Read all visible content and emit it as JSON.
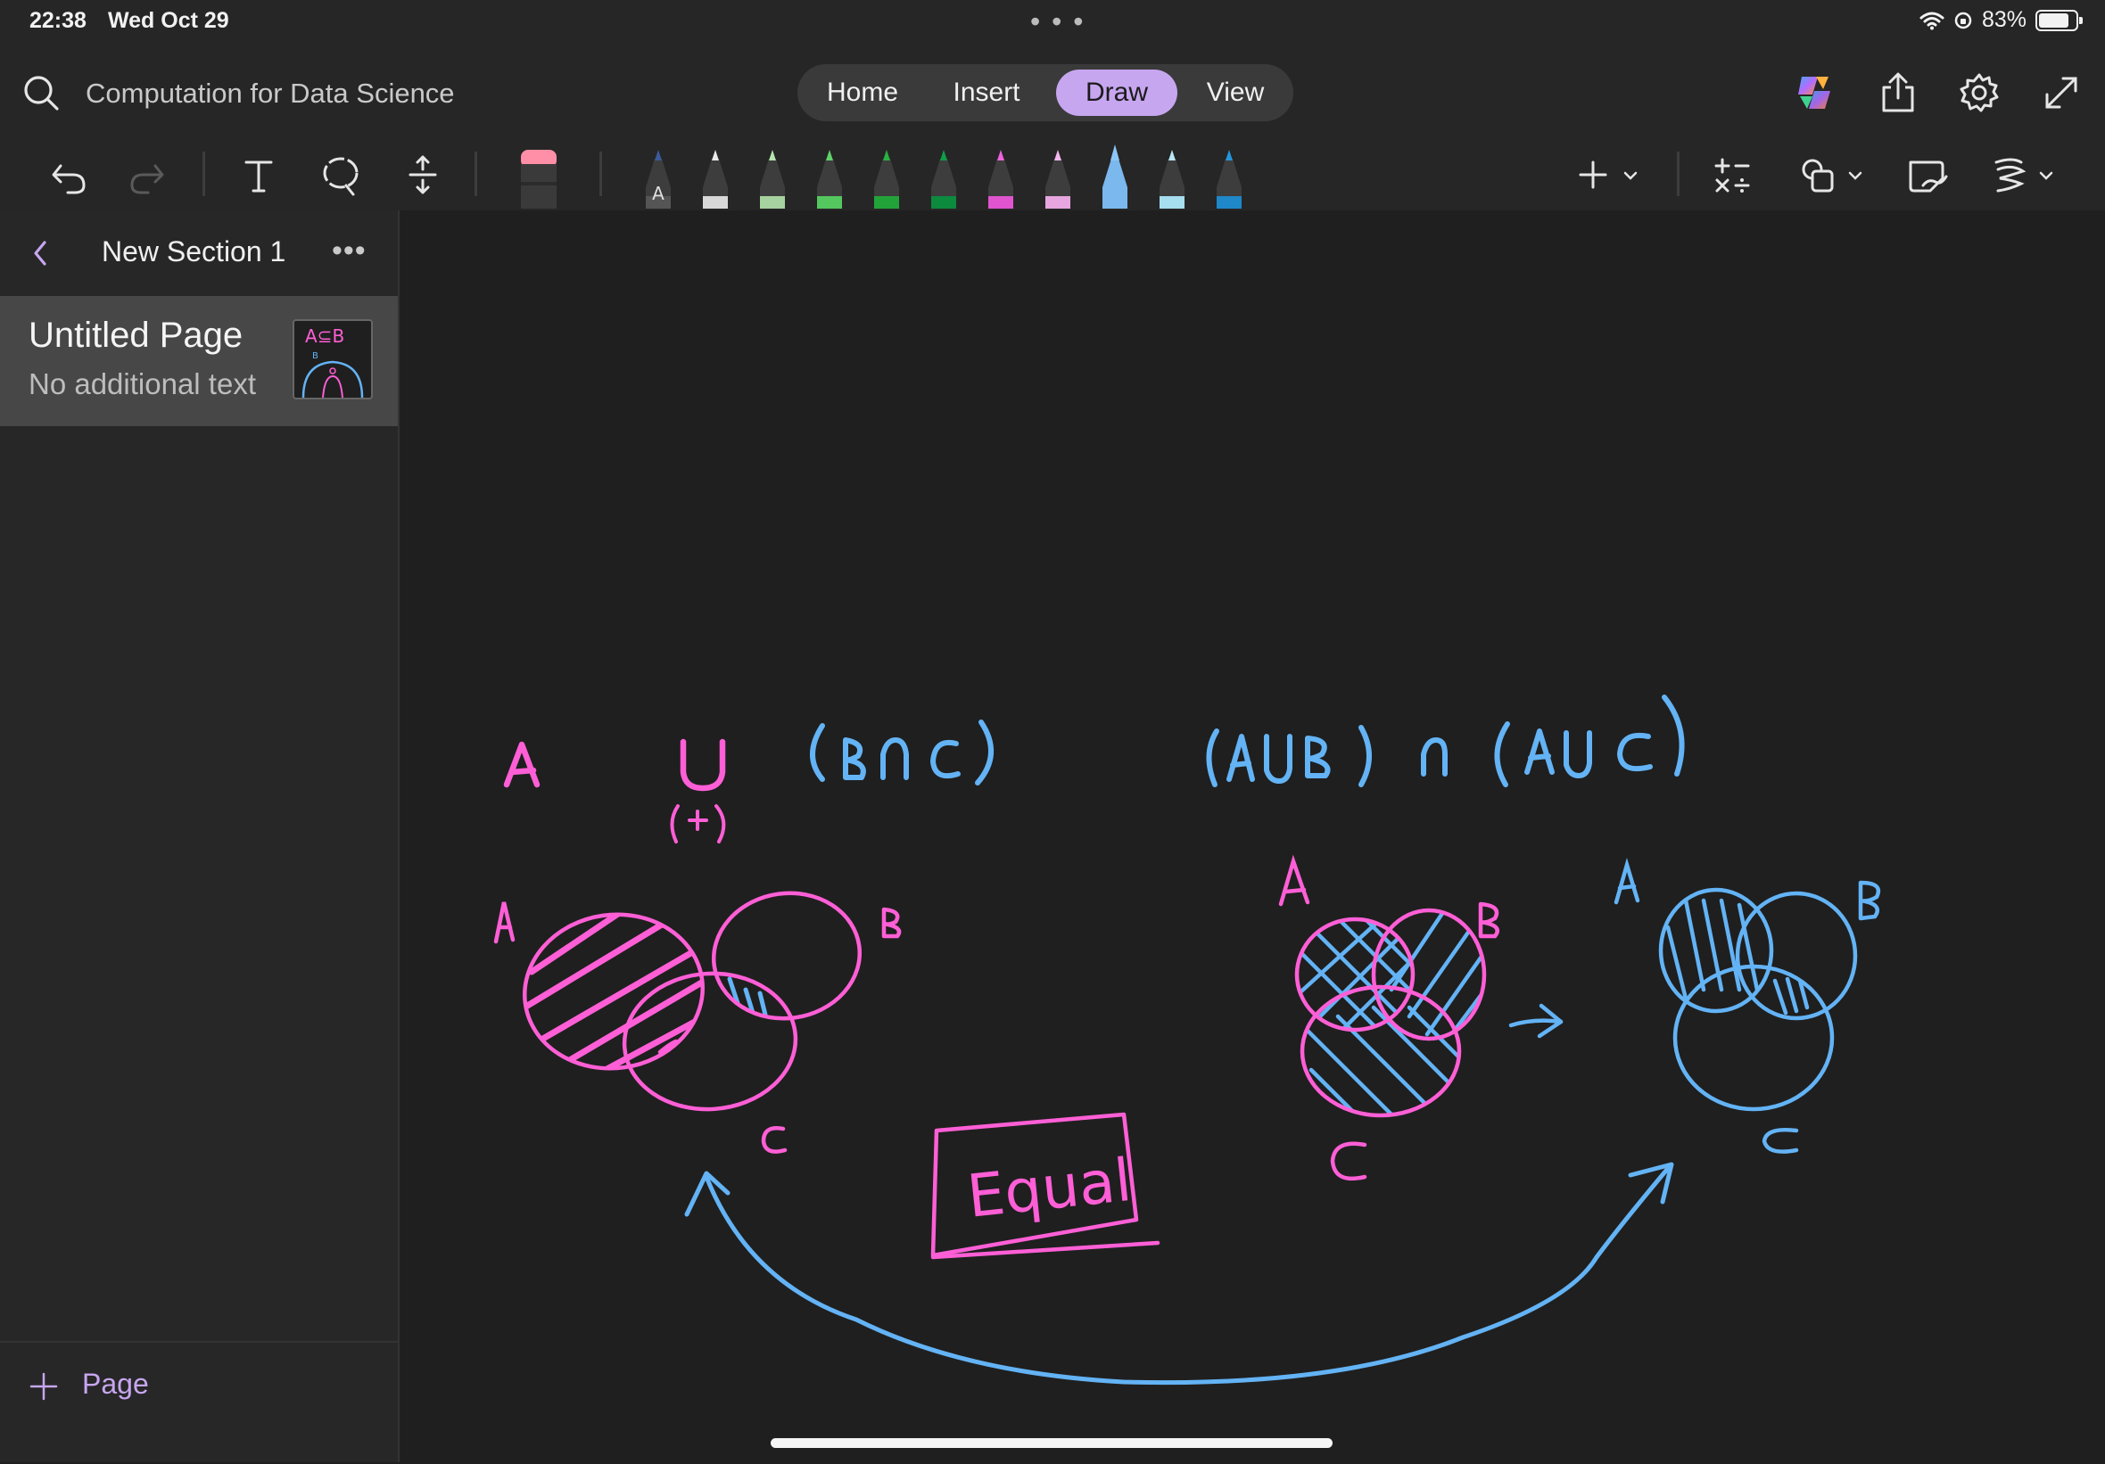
{
  "status_bar": {
    "time": "22:38",
    "date": "Wed Oct 29",
    "battery": "83%",
    "battery_level": 0.83
  },
  "notebook": {
    "title": "Computation for Data Science"
  },
  "tabs": [
    {
      "label": "Home",
      "active": false
    },
    {
      "label": "Insert",
      "active": false
    },
    {
      "label": "Draw",
      "active": true
    },
    {
      "label": "View",
      "active": false
    }
  ],
  "colors": {
    "accent": "#c7a6f0",
    "ink_pink": "#ff5fd6",
    "ink_blue": "#63b3f5"
  },
  "toolbar": {
    "icons": [
      "undo-icon",
      "redo-icon",
      "text-icon",
      "lasso-icon",
      "insert-space-icon",
      "eraser-icon",
      "add-pen-icon",
      "math-icon",
      "shapes-icon",
      "ink-to-shape-icon",
      "ink-to-text-icon"
    ],
    "pens": [
      {
        "color": "#555555",
        "tip": "#3b5a9a"
      },
      {
        "color": "#d8d8d8",
        "tip": "#e8e8e8"
      },
      {
        "color": "#a7d3a0",
        "tip": "#b5e5ae"
      },
      {
        "color": "#55c75f",
        "tip": "#5fd36a"
      },
      {
        "color": "#22a33a",
        "tip": "#28b342"
      },
      {
        "color": "#0c8a3e",
        "tip": "#0f9d48"
      },
      {
        "color": "#e054cf",
        "tip": "#ef62de"
      },
      {
        "color": "#e7a6e0",
        "tip": "#f3b7ee"
      },
      {
        "color": "#7ab8ee",
        "tip": "#8cc6f8"
      },
      {
        "color": "#a6ddef",
        "tip": "#b8e8f6"
      },
      {
        "color": "#1e88c8",
        "tip": "#2396dc"
      }
    ]
  },
  "sidebar": {
    "section_title": "New Section 1",
    "pages": [
      {
        "title": "Untitled Page",
        "subtitle": "No additional text"
      }
    ],
    "add_page_label": "Page"
  },
  "canvas": {
    "handwriting": [
      {
        "text": "A",
        "color": "#ff5fd6"
      },
      {
        "text": "U",
        "color": "#ff5fd6"
      },
      {
        "text": "(+)",
        "color": "#ff5fd6"
      },
      {
        "text": "(B∩C)",
        "color": "#63b3f5"
      },
      {
        "text": "(AUB) ∩ (AUC)",
        "color": "#63b3f5"
      },
      {
        "text": "A",
        "color": "#ff5fd6"
      },
      {
        "text": "B",
        "color": "#ff5fd6"
      },
      {
        "text": "C",
        "color": "#ff5fd6"
      },
      {
        "text": "A",
        "color": "#ff5fd6"
      },
      {
        "text": "B",
        "color": "#ff5fd6"
      },
      {
        "text": "C",
        "color": "#ff5fd6"
      },
      {
        "text": "A",
        "color": "#63b3f5"
      },
      {
        "text": "B",
        "color": "#63b3f5"
      },
      {
        "text": "C",
        "color": "#63b3f5"
      },
      {
        "text": "Equal",
        "color": "#ff5fd6"
      }
    ]
  }
}
